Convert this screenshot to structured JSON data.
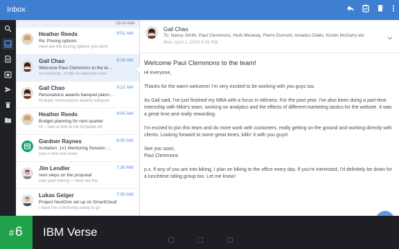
{
  "topbar": {
    "title": "Inbox",
    "icons": [
      "reply-icon",
      "mark-done-icon",
      "trash-icon",
      "more-icon"
    ]
  },
  "rail": {
    "items": [
      "search-icon",
      "inbox-icon",
      "document-icon",
      "calendar-icon",
      "send-icon",
      "trash-icon",
      "folder-icon"
    ]
  },
  "list": {
    "status": "Up-to-date",
    "mails": [
      {
        "from": "Heather Reeds",
        "time": "9:51 AM",
        "subject": "Re: Pricing options",
        "preview": "Here are the pricing options you were"
      },
      {
        "from": "Gail Chao",
        "time": "9:26 AM",
        "subject": "Welcome Paul Clemmons to the te…",
        "preview": "Hi everyone, I'd like to welcome Paul"
      },
      {
        "from": "Gail Chao",
        "time": "9:12 AM",
        "subject": "Renovations awards banquet plann…",
        "preview": "Hi team, Renovations awards banquet"
      },
      {
        "from": "Heather Reeds",
        "time": "9:05 AM",
        "subject": "Budget planning for next quarter",
        "preview": "Hi – take a look at the template we"
      },
      {
        "from": "Gardner Raynes",
        "time": "8:30 AM",
        "subject": "Invitation: 1x1 Mentoring Session …",
        "preview": "Dial in 800-555-4545"
      },
      {
        "from": "Jim Lendler",
        "time": "7:30 AM",
        "subject": "next steps on the proposal",
        "preview": "Gail (and Nancy) – Here are the"
      },
      {
        "from": "Lukas Geiger",
        "time": "7:00 AM",
        "subject": "Project NextOne set up on SmartCloud",
        "preview": "I have the community ready to go"
      }
    ]
  },
  "reader": {
    "sender": "Gail Chao",
    "to": "To: Nancy Smith, Paul Clemmons, Herb Medway, Pierre Dumont, Amadou Diallo, Kristin McGarry etc",
    "date": "Mon, April 1, 2015 9:26 PM",
    "title": "Welcome Paul Clemmons to the team!",
    "paragraphs": [
      "Hi everyone,",
      "Thanks for the warm welcome! I'm very excited to be working with you guys too.",
      "As Gail said, I've just finished my MBA with a focus in eBiness. For the past year, I've also been doing a part-time internship with Mike's team, working on analytics and the effects of different marketing tactics for the website. It was a great time and really rewarding.",
      "I'm excited to join this team and do more work with customers, really getting on the ground and working directly with clients. Looking forward to some great times, killin' it with you guys!",
      "See you soon,\nPaul Clemmons",
      "p.s. If any of you are into biking, I plan on biking to the office every day. If you're interested, I'd definitely be down for a lunchtime riding group too. Let me know!"
    ]
  },
  "banner": {
    "hash": "#",
    "rank": "6",
    "app_name": "IBM Verse"
  },
  "colors": {
    "topbar": "#3f7fd1",
    "rail": "#1f2125",
    "accent": "#4a86d8",
    "rank_badge": "#21a24a",
    "banner": "#1d1f24"
  }
}
